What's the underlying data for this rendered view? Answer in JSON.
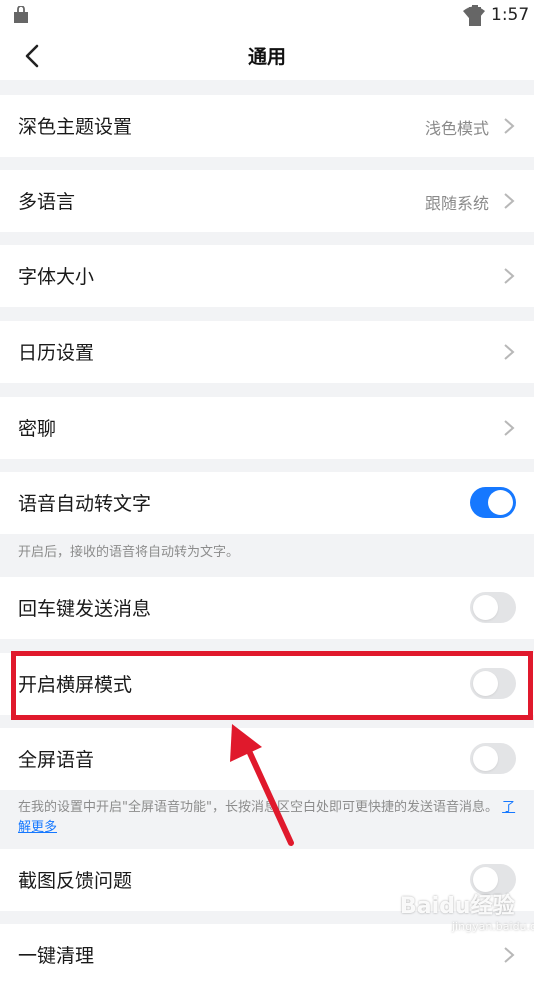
{
  "status_bar": {
    "time": "1:57"
  },
  "header": {
    "title": "通用"
  },
  "rows": [
    {
      "label": "深色主题设置",
      "value": "浅色模式"
    },
    {
      "label": "多语言",
      "value": "跟随系统"
    },
    {
      "label": "字体大小"
    },
    {
      "label": "日历设置"
    },
    {
      "label": "密聊"
    }
  ],
  "toggles": [
    {
      "label": "语音自动转文字",
      "on": true,
      "note": "开启后，接收的语音将自动转为文字。"
    },
    {
      "label": "回车键发送消息",
      "on": false
    },
    {
      "label": "开启横屏模式",
      "on": false
    },
    {
      "label": "全屏语音",
      "on": false,
      "note": "在我的设置中开启\"全屏语音功能\"，长按消息区空白处即可更快捷的发送语音消息。",
      "note_link": "了解更多"
    },
    {
      "label": "截图反馈问题",
      "on": false
    },
    {
      "label": "一键清理"
    }
  ],
  "annotation": {
    "highlight_color": "#e0192c",
    "highlight_target": "开启横屏模式"
  },
  "watermark": {
    "text": "Baidu经验",
    "sub": "jingyan.baidu.com"
  },
  "colors": {
    "accent": "#1678ff",
    "background": "#f2f3f5"
  }
}
